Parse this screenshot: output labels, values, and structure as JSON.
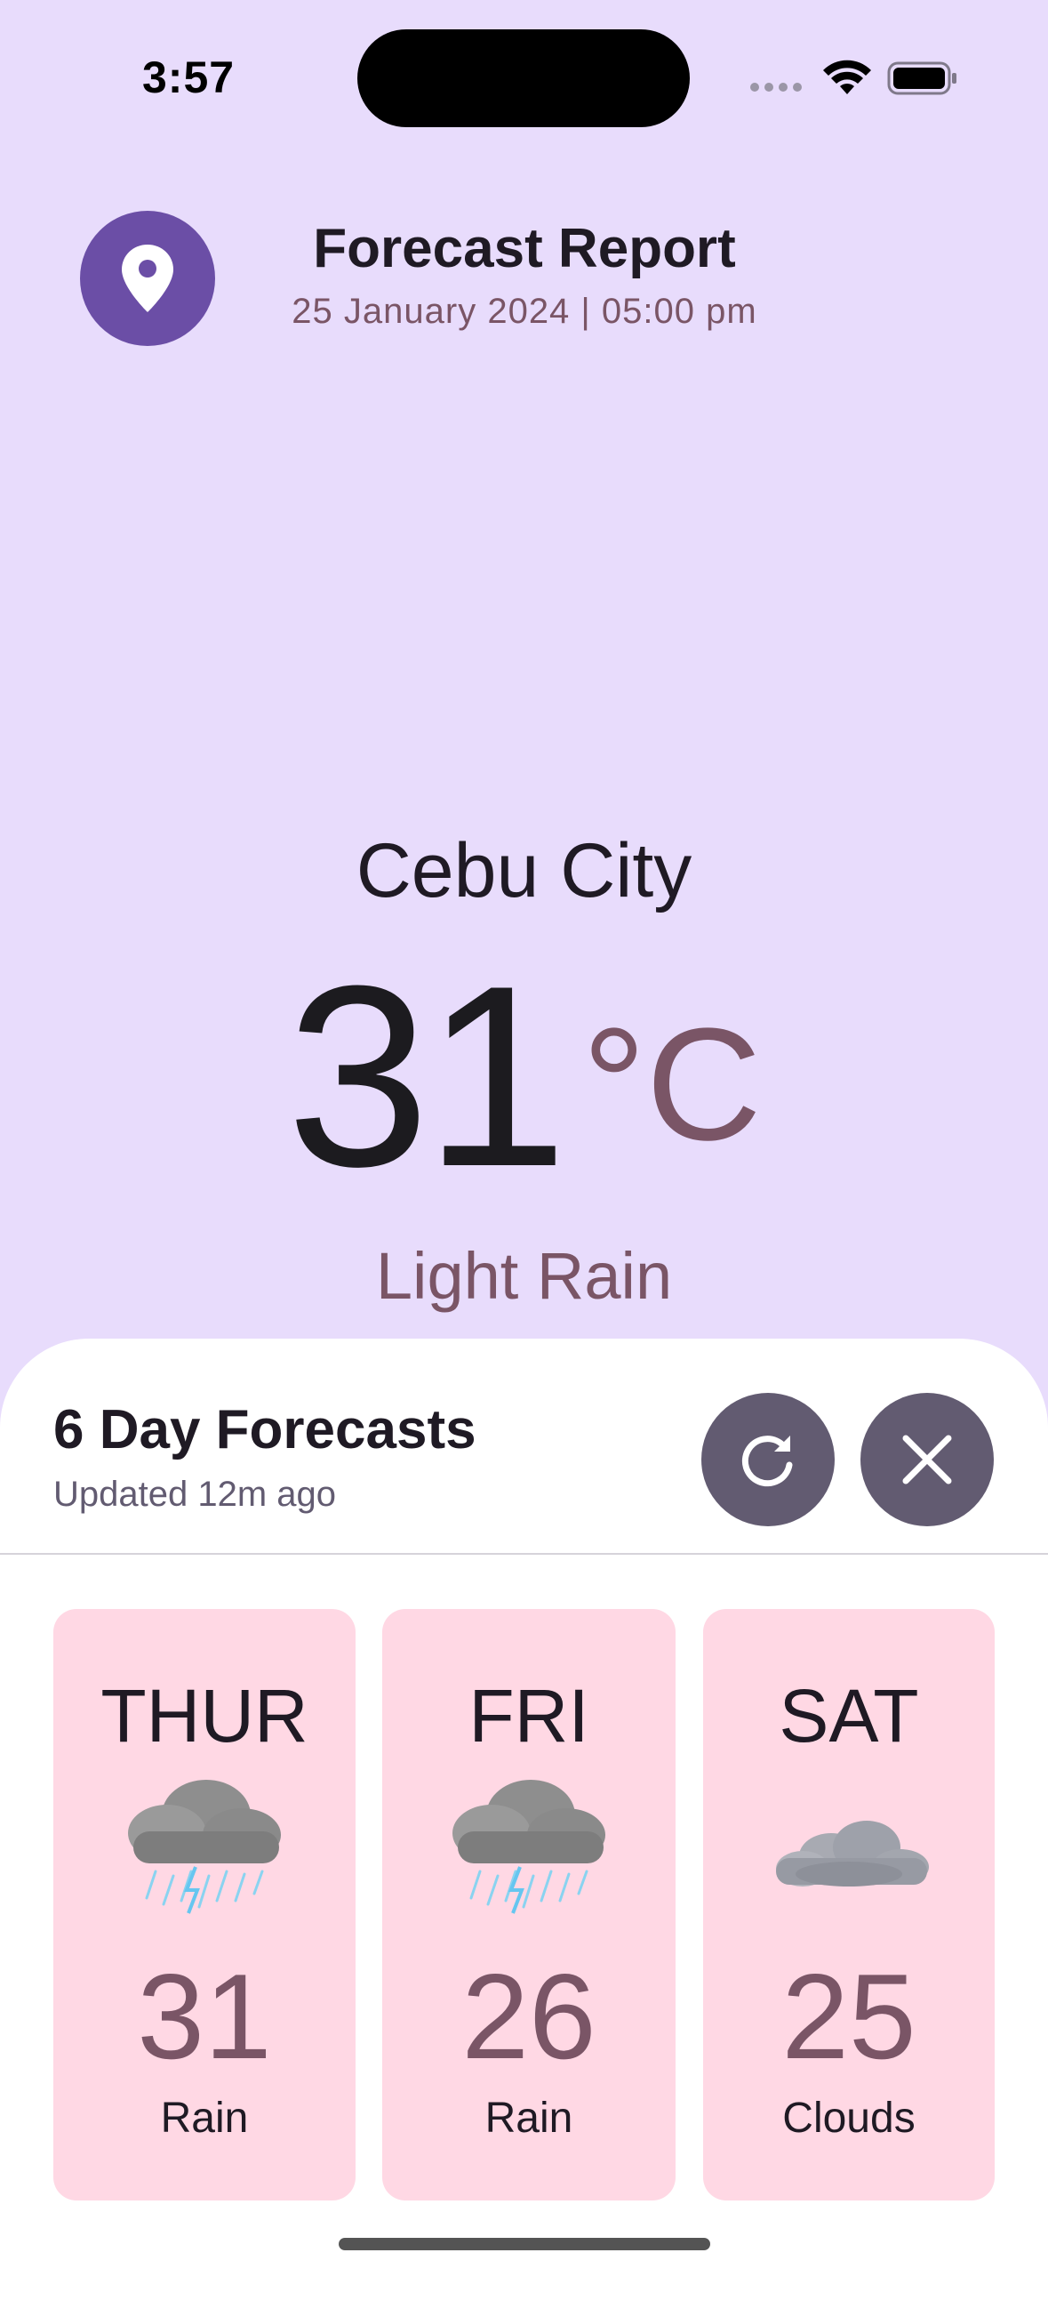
{
  "status_bar": {
    "time": "3:57"
  },
  "header": {
    "icon": "location-pin-icon",
    "title": "Forecast Report",
    "subtitle": "25 January 2024 | 05:00 pm",
    "accent_color": "#6b4ea6"
  },
  "current": {
    "city": "Cebu City",
    "temperature": "31",
    "unit": "°C",
    "condition": "Light Rain"
  },
  "forecast_sheet": {
    "title": "6 Day Forecasts",
    "updated": "Updated 12m ago",
    "refresh_icon": "refresh-icon",
    "close_icon": "close-icon",
    "days": [
      {
        "day": "THUR",
        "icon": "thunderstorm-rain-cloud-icon",
        "temp": "31",
        "desc": "Rain"
      },
      {
        "day": "FRI",
        "icon": "thunderstorm-rain-cloud-icon",
        "temp": "26",
        "desc": "Rain"
      },
      {
        "day": "SAT",
        "icon": "clouds-icon",
        "temp": "25",
        "desc": "Clouds"
      }
    ]
  },
  "colors": {
    "background": "#e8dcfc",
    "card": "#ffd8e4",
    "secondary_text": "#7a5566",
    "button": "#625b71"
  }
}
